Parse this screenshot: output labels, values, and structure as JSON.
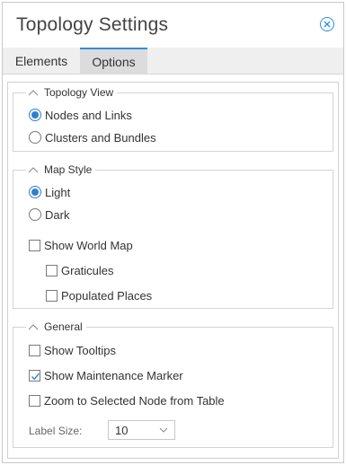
{
  "dialog": {
    "title": "Topology Settings",
    "close_icon": "close-circle-icon"
  },
  "tabs": [
    {
      "label": "Elements",
      "active": false
    },
    {
      "label": "Options",
      "active": true
    }
  ],
  "topology_view": {
    "legend": "Topology View",
    "options": [
      {
        "label": "Nodes and Links",
        "selected": true
      },
      {
        "label": "Clusters and Bundles",
        "selected": false
      }
    ]
  },
  "map_style": {
    "legend": "Map Style",
    "options": [
      {
        "label": "Light",
        "selected": true
      },
      {
        "label": "Dark",
        "selected": false
      }
    ],
    "show_world_map": {
      "label": "Show World Map",
      "checked": false
    },
    "graticules": {
      "label": "Graticules",
      "checked": false
    },
    "populated_places": {
      "label": "Populated Places",
      "checked": false
    }
  },
  "general": {
    "legend": "General",
    "show_tooltips": {
      "label": "Show Tooltips",
      "checked": false
    },
    "show_maintenance_marker": {
      "label": "Show Maintenance Marker",
      "checked": true
    },
    "zoom_to_selected": {
      "label": "Zoom to Selected Node from Table",
      "checked": false
    },
    "label_size": {
      "label": "Label Size:",
      "value": "10"
    }
  },
  "colors": {
    "accent": "#2f8fd8",
    "border": "#d4d4d4",
    "tab_bar": "#efefef"
  }
}
